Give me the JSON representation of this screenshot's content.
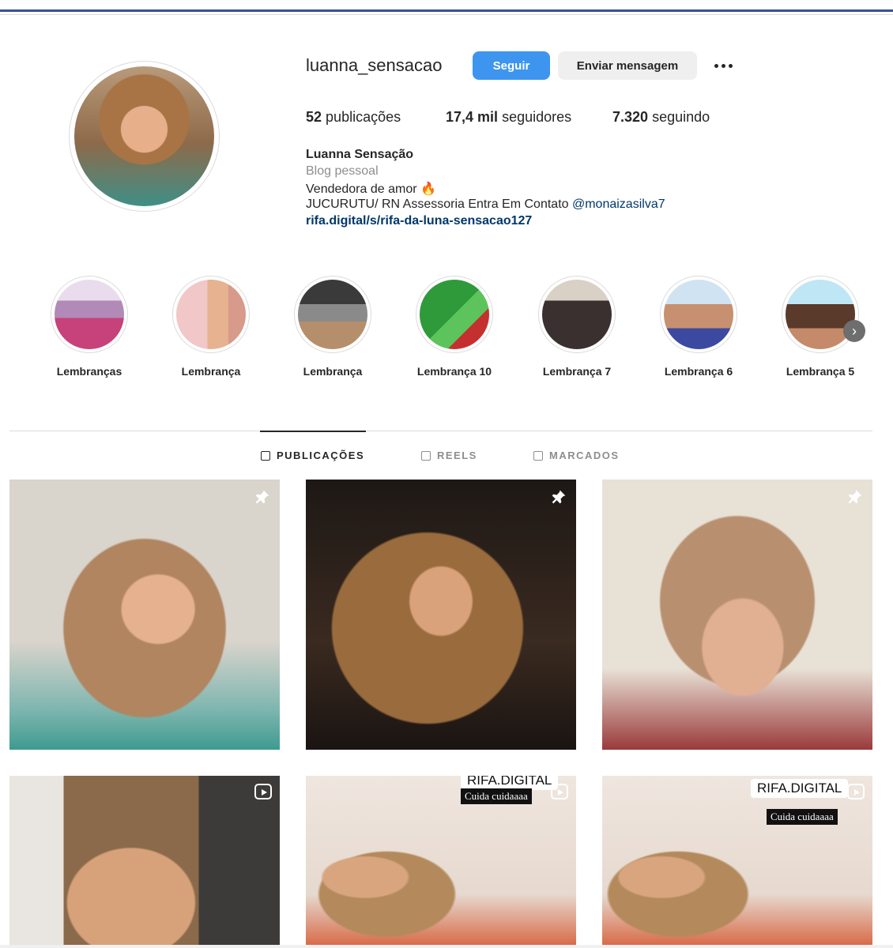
{
  "profile": {
    "username": "luanna_sensacao",
    "follow_label": "Seguir",
    "message_label": "Enviar mensagem",
    "stats": {
      "posts_value": "52",
      "posts_label": "publicações",
      "followers_value": "17,4 mil",
      "followers_label": "seguidores",
      "following_value": "7.320",
      "following_label": "seguindo"
    },
    "bio": {
      "name": "Luanna Sensação",
      "category": "Blog pessoal",
      "line1": "Vendedora de amor 🔥",
      "line2": "JUCURUTU/ RN Assessoria Entra Em Contato ",
      "mention": "@monaizasilva7",
      "link": "rifa.digital/s/rifa-da-luna-sensacao127"
    }
  },
  "highlights": [
    {
      "label": "Lembranças"
    },
    {
      "label": "Lembrança"
    },
    {
      "label": "Lembrança"
    },
    {
      "label": "Lembrança 10"
    },
    {
      "label": "Lembrança 7"
    },
    {
      "label": "Lembrança 6"
    },
    {
      "label": "Lembrança 5"
    }
  ],
  "tabs": [
    {
      "label": "PUBLICAÇÕES",
      "icon": "grid-icon",
      "active": true
    },
    {
      "label": "REELS",
      "icon": "reels-icon",
      "active": false
    },
    {
      "label": "MARCADOS",
      "icon": "tagged-icon",
      "active": false
    }
  ],
  "posts": [
    {
      "type": "pinned"
    },
    {
      "type": "pinned"
    },
    {
      "type": "pinned"
    },
    {
      "type": "reel"
    },
    {
      "type": "reel",
      "sticker": "RIFA.DIGITAL",
      "caption": "Cuida cuidaaaa"
    },
    {
      "type": "reel",
      "sticker": "RIFA.DIGITAL",
      "caption": "Cuida cuidaaaa"
    }
  ],
  "colors": {
    "accent": "#3d95f0",
    "link": "#00376b",
    "muted": "#8e8e8e"
  }
}
